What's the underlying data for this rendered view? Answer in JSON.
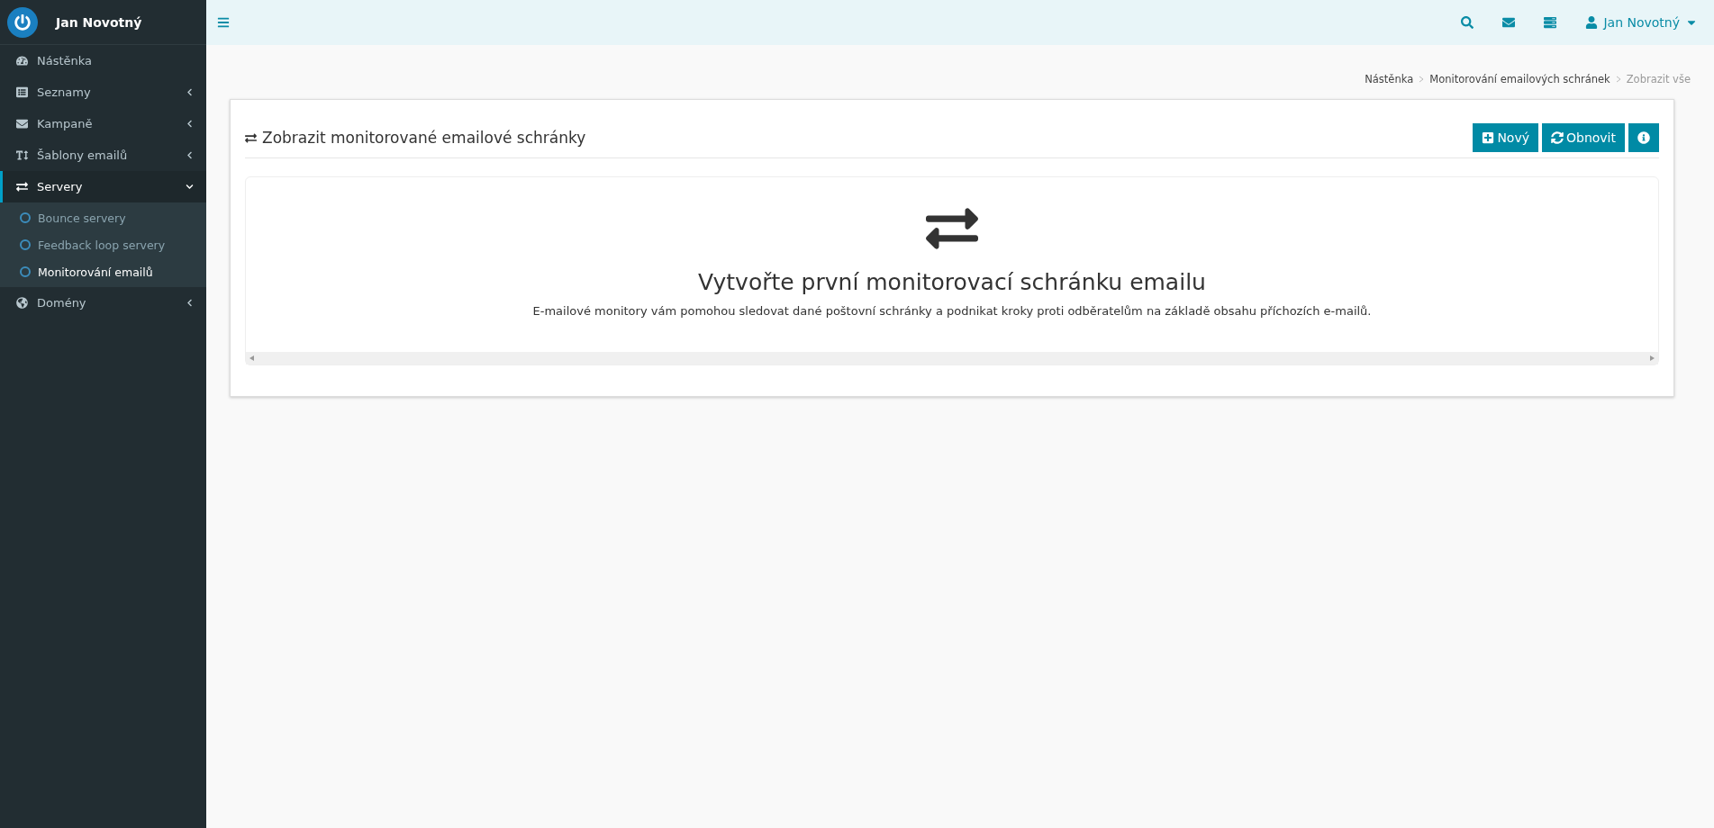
{
  "sidebar": {
    "brand": "Jan Novotný",
    "items": [
      {
        "label": "Nástěnka",
        "selected": false
      },
      {
        "label": "Seznamy",
        "selected": false,
        "expanded": false
      },
      {
        "label": "Kampaně",
        "selected": false,
        "expanded": false
      },
      {
        "label": "Šablony emailů",
        "selected": false,
        "expanded": false
      },
      {
        "label": "Servery",
        "selected": true,
        "expanded": true,
        "children": [
          {
            "label": "Bounce servery",
            "selected": false
          },
          {
            "label": "Feedback loop servery",
            "selected": false
          },
          {
            "label": "Monitorování emailů",
            "selected": true
          }
        ]
      },
      {
        "label": "Domény",
        "selected": false,
        "expanded": false
      }
    ]
  },
  "topbar": {
    "user": "Jan Novotný"
  },
  "breadcrumb": [
    "Nástěnka",
    "Monitorování emailových schránek",
    "Zobrazit vše"
  ],
  "panel": {
    "title": "Zobrazit monitorované emailové schránky",
    "buttons": [
      {
        "kind": "new",
        "label": "Nový"
      },
      {
        "kind": "refresh",
        "label": "Obnovit"
      },
      {
        "kind": "info"
      }
    ],
    "empty": {
      "heading": "Vytvořte první monitorovací schránku emailu",
      "text": "E-mailové monitory vám pomohou sledovat dané poštovní schránky a podnikat kroky proti odběratelům na základě obsahu příchozích e-mailů."
    }
  }
}
